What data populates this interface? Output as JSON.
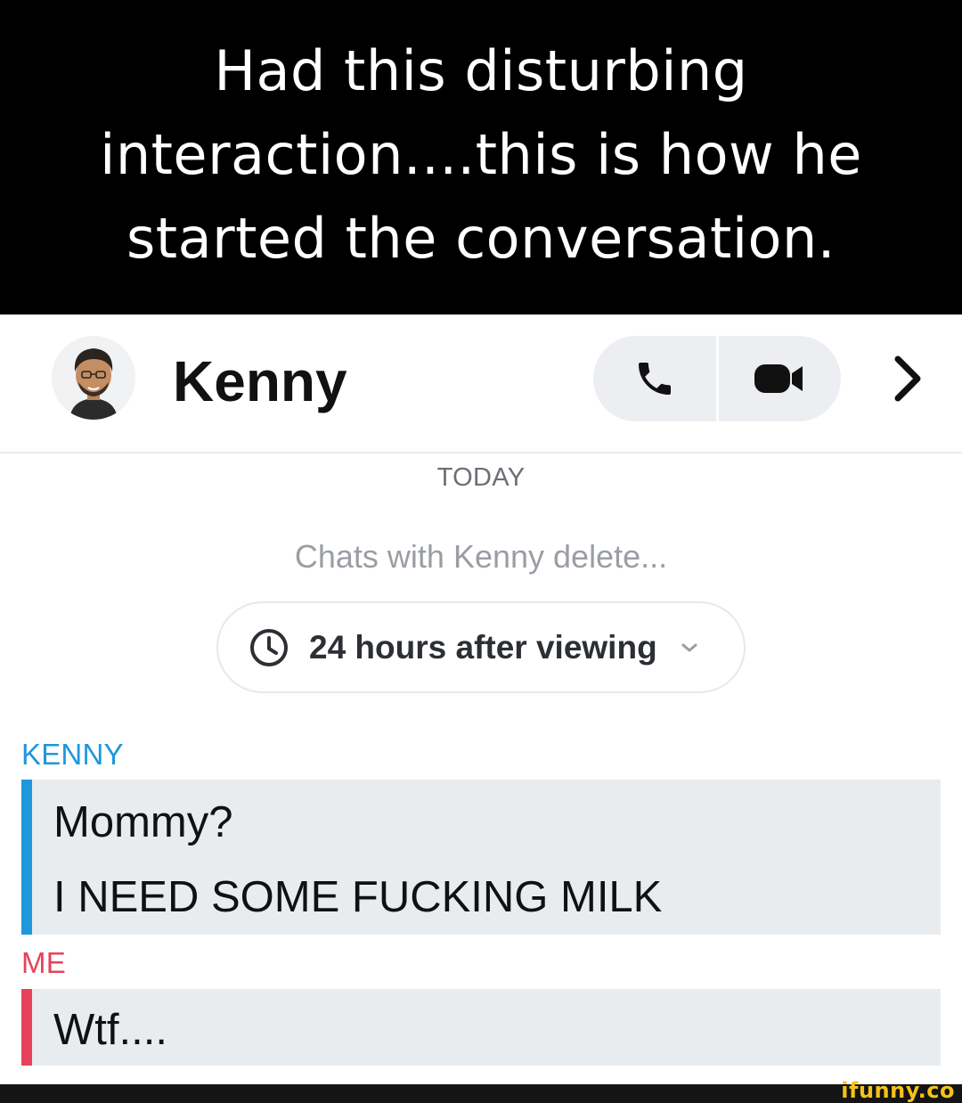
{
  "caption": {
    "lines": [
      "Had this disturbing",
      "interaction....this is how he",
      "started the conversation."
    ]
  },
  "header": {
    "contact_name": "Kenny",
    "avatar_icon": "bitmoji-avatar-icon",
    "call_icon": "phone-icon",
    "video_icon": "video-camera-icon",
    "more_icon": "chevron-right-icon"
  },
  "chat": {
    "date_label": "TODAY",
    "delete_note": "Chats with Kenny delete...",
    "timer": {
      "icon": "clock-icon",
      "label": "24 hours after viewing",
      "dropdown_icon": "chevron-down-icon"
    },
    "messages": [
      {
        "sender": "KENNY",
        "lines": [
          "Mommy?",
          "I NEED SOME FUCKING MILK"
        ]
      },
      {
        "sender": "ME",
        "lines": [
          "Wtf...."
        ]
      }
    ]
  },
  "watermark": "ifunny.co",
  "colors": {
    "kenny_accent": "#1e97dc",
    "me_accent": "#e8415b",
    "bubble_bg": "#e9ecef",
    "watermark": "#f4c21b"
  }
}
